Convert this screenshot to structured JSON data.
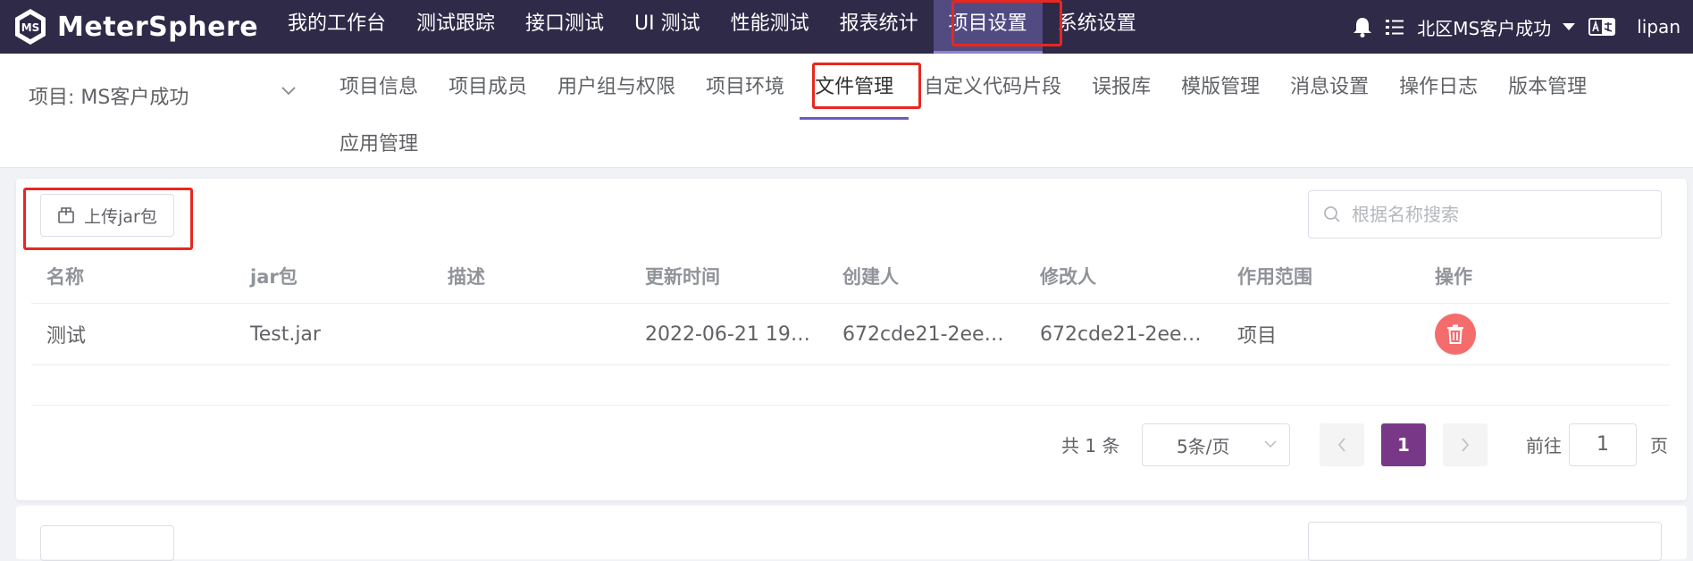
{
  "app": {
    "brand": "MeterSphere"
  },
  "topnav": {
    "items": [
      "我的工作台",
      "测试跟踪",
      "接口测试",
      "UI 测试",
      "性能测试",
      "报表统计",
      "项目设置",
      "系统设置"
    ],
    "active_index": 6
  },
  "topright": {
    "workspace": "北区MS客户成功",
    "user": "lipan"
  },
  "project_select": {
    "label": "项目: MS客户成功"
  },
  "subnav": {
    "tabs": [
      "项目信息",
      "项目成员",
      "用户组与权限",
      "项目环境",
      "文件管理",
      "自定义代码片段",
      "误报库",
      "模版管理",
      "消息设置",
      "操作日志",
      "版本管理",
      "应用管理"
    ],
    "active_index": 4
  },
  "toolbar": {
    "upload_label": "上传jar包"
  },
  "search": {
    "placeholder": "根据名称搜索",
    "value": ""
  },
  "table": {
    "columns": [
      "名称",
      "jar包",
      "描述",
      "更新时间",
      "创建人",
      "修改人",
      "作用范围",
      "操作"
    ],
    "rows": [
      {
        "name": "测试",
        "jar": "Test.jar",
        "description": "",
        "updated": "2022-06-21 19:…",
        "creator": "672cde21-2eed…",
        "modifier": "672cde21-2eed…",
        "scope": "项目"
      }
    ]
  },
  "pagination": {
    "total": "共 1 条",
    "page_size": "5条/页",
    "current": "1",
    "goto_label": "前往",
    "goto_value": "1",
    "page_suffix": "页"
  },
  "colors": {
    "topbar": "#2e2a48",
    "accent": "#783887",
    "danger": "#f56c6c",
    "highlight": "#e8271f"
  }
}
